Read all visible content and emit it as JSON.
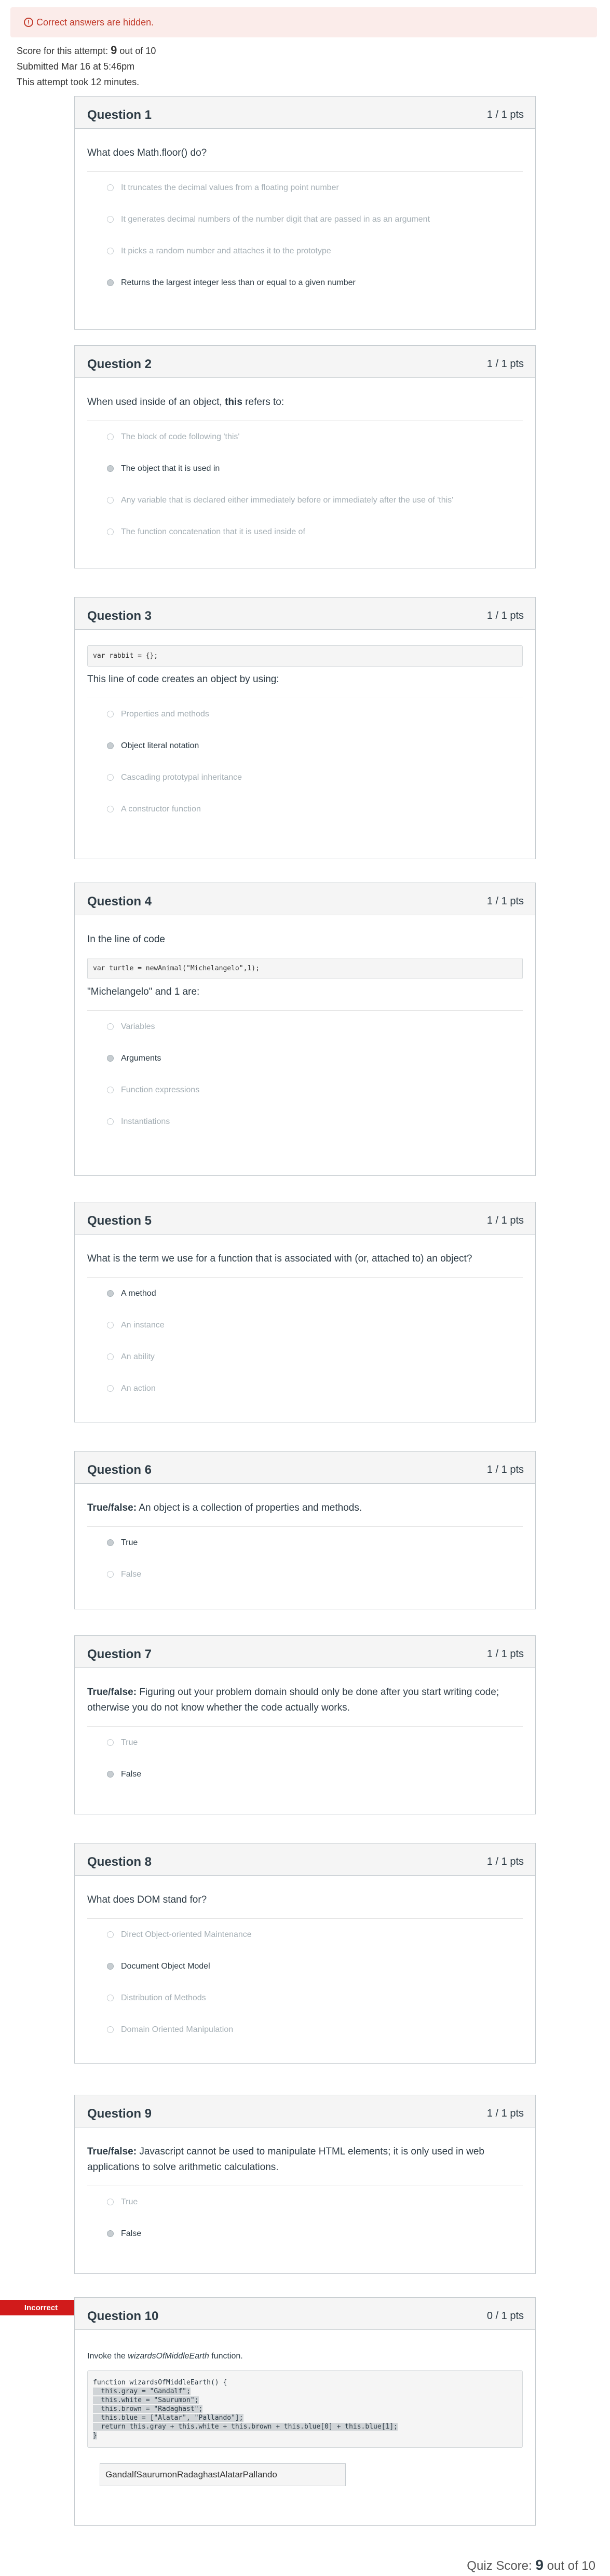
{
  "alert": {
    "icon": "info-icon",
    "text": "Correct answers are hidden."
  },
  "summary": {
    "score_prefix": "Score for this attempt: ",
    "score": "9",
    "score_suffix": " out of 10",
    "submitted": "Submitted Mar 16 at 5:46pm",
    "duration": "This attempt took 12 minutes."
  },
  "questions": [
    {
      "title": "Question 1",
      "points": "1 / 1 pts",
      "text": "What does Math.floor() do?",
      "answers": [
        {
          "label": "It truncates the decimal values from a floating point number",
          "selected": false
        },
        {
          "label": "It generates decimal numbers of the number digit that are passed in as an argument",
          "selected": false
        },
        {
          "label": "It picks a random number and attaches it to the prototype",
          "selected": false
        },
        {
          "label": "Returns the largest integer less than or equal to a given number",
          "selected": true
        }
      ]
    },
    {
      "title": "Question 2",
      "points": "1 / 1 pts",
      "text_pre": "When used inside of an object, ",
      "text_bold": "this",
      "text_post": " refers to:",
      "answers": [
        {
          "label": "The block of code following 'this'",
          "selected": false
        },
        {
          "label": "The object that it is used in",
          "selected": true
        },
        {
          "label": "Any variable that is declared either immediately before or immediately after the use of 'this'",
          "selected": false
        },
        {
          "label": "The function concatenation that it is used inside of",
          "selected": false
        }
      ]
    },
    {
      "title": "Question 3",
      "points": "1 / 1 pts",
      "code": "var rabbit = {};",
      "text": "This line of code creates an object by using:",
      "answers": [
        {
          "label": "Properties and methods",
          "selected": false
        },
        {
          "label": "Object literal notation",
          "selected": true
        },
        {
          "label": "Cascading prototypal inheritance",
          "selected": false
        },
        {
          "label": "A constructor function",
          "selected": false
        }
      ]
    },
    {
      "title": "Question 4",
      "points": "1 / 1 pts",
      "text": "In the line of code",
      "code": "var turtle = newAnimal(\"Michelangelo\",1);",
      "text2": "\"Michelangelo\" and 1 are:",
      "answers": [
        {
          "label": "Variables",
          "selected": false
        },
        {
          "label": "Arguments",
          "selected": true
        },
        {
          "label": "Function expressions",
          "selected": false
        },
        {
          "label": "Instantiations",
          "selected": false
        }
      ]
    },
    {
      "title": "Question 5",
      "points": "1 / 1 pts",
      "text": "What is the term we use for a function that is associated with (or, attached to) an object?",
      "answers": [
        {
          "label": "A method",
          "selected": true
        },
        {
          "label": "An instance",
          "selected": false
        },
        {
          "label": "An ability",
          "selected": false
        },
        {
          "label": "An action",
          "selected": false
        }
      ]
    },
    {
      "title": "Question 6",
      "points": "1 / 1 pts",
      "text_bold": "True/false:",
      "text_post": " An object is a collection of properties and methods.",
      "answers": [
        {
          "label": "True",
          "selected": true
        },
        {
          "label": "False",
          "selected": false
        }
      ]
    },
    {
      "title": "Question 7",
      "points": "1 / 1 pts",
      "text_bold": "True/false:",
      "text_post": " Figuring out your problem domain should only be done after you start writing code; otherwise you do not know whether the code actually works.",
      "answers": [
        {
          "label": "True",
          "selected": false
        },
        {
          "label": "False",
          "selected": true
        }
      ]
    },
    {
      "title": "Question 8",
      "points": "1 / 1 pts",
      "text": "What does DOM stand for?",
      "answers": [
        {
          "label": "Direct Object-oriented Maintenance",
          "selected": false
        },
        {
          "label": "Document Object Model",
          "selected": true
        },
        {
          "label": "Distribution of Methods",
          "selected": false
        },
        {
          "label": "Domain Oriented Manipulation",
          "selected": false
        }
      ]
    },
    {
      "title": "Question 9",
      "points": "1 / 1 pts",
      "text_bold": "True/false:",
      "text_post": " Javascript cannot be used to manipulate HTML elements; it is only used in web applications to solve arithmetic calculations.",
      "answers": [
        {
          "label": "True",
          "selected": false
        },
        {
          "label": "False",
          "selected": true
        }
      ]
    }
  ],
  "q10": {
    "badge": "Incorrect",
    "title": "Question 10",
    "points": "0 / 1 pts",
    "text_pre": "Invoke the ",
    "text_em": "wizardsOfMiddleEarth",
    "text_post": " function.",
    "code_lines": [
      "function wizardsOfMiddleEarth() {",
      "  this.gray = \"Gandalf\";",
      "  this.white = \"Saurumon\";",
      "  this.brown = \"Radaghast\";",
      "  this.blue = [\"Alatar\", \"Pallando\"];",
      "  return this.gray + this.white + this.brown + this.blue[0] + this.blue[1];",
      "}"
    ],
    "answer": "GandalfSaurumonRadaghastAlatarPallando"
  },
  "final": {
    "prefix": "Quiz Score: ",
    "score": "9",
    "suffix": " out of 10"
  }
}
